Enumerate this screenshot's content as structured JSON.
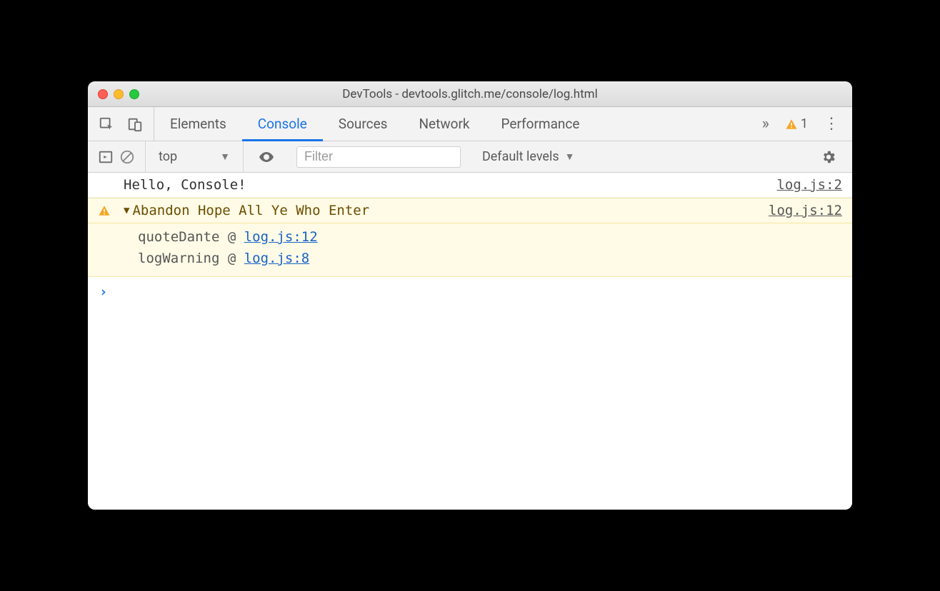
{
  "window": {
    "title": "DevTools - devtools.glitch.me/console/log.html"
  },
  "tabs": {
    "items": [
      "Elements",
      "Console",
      "Sources",
      "Network",
      "Performance"
    ],
    "active": "Console",
    "moreGlyph": "»",
    "warningCount": "1"
  },
  "toolbar": {
    "context": "top",
    "filterPlaceholder": "Filter",
    "levelsLabel": "Default levels"
  },
  "logs": {
    "r0": {
      "text": "Hello, Console!",
      "source": "log.js:2"
    },
    "r1": {
      "text": "Abandon Hope All Ye Who Enter",
      "source": "log.js:12",
      "stack": [
        {
          "fn": "quoteDante",
          "at": "@",
          "loc": "log.js:12"
        },
        {
          "fn": "logWarning",
          "at": "@",
          "loc": "log.js:8"
        }
      ]
    }
  },
  "promptGlyph": "›"
}
